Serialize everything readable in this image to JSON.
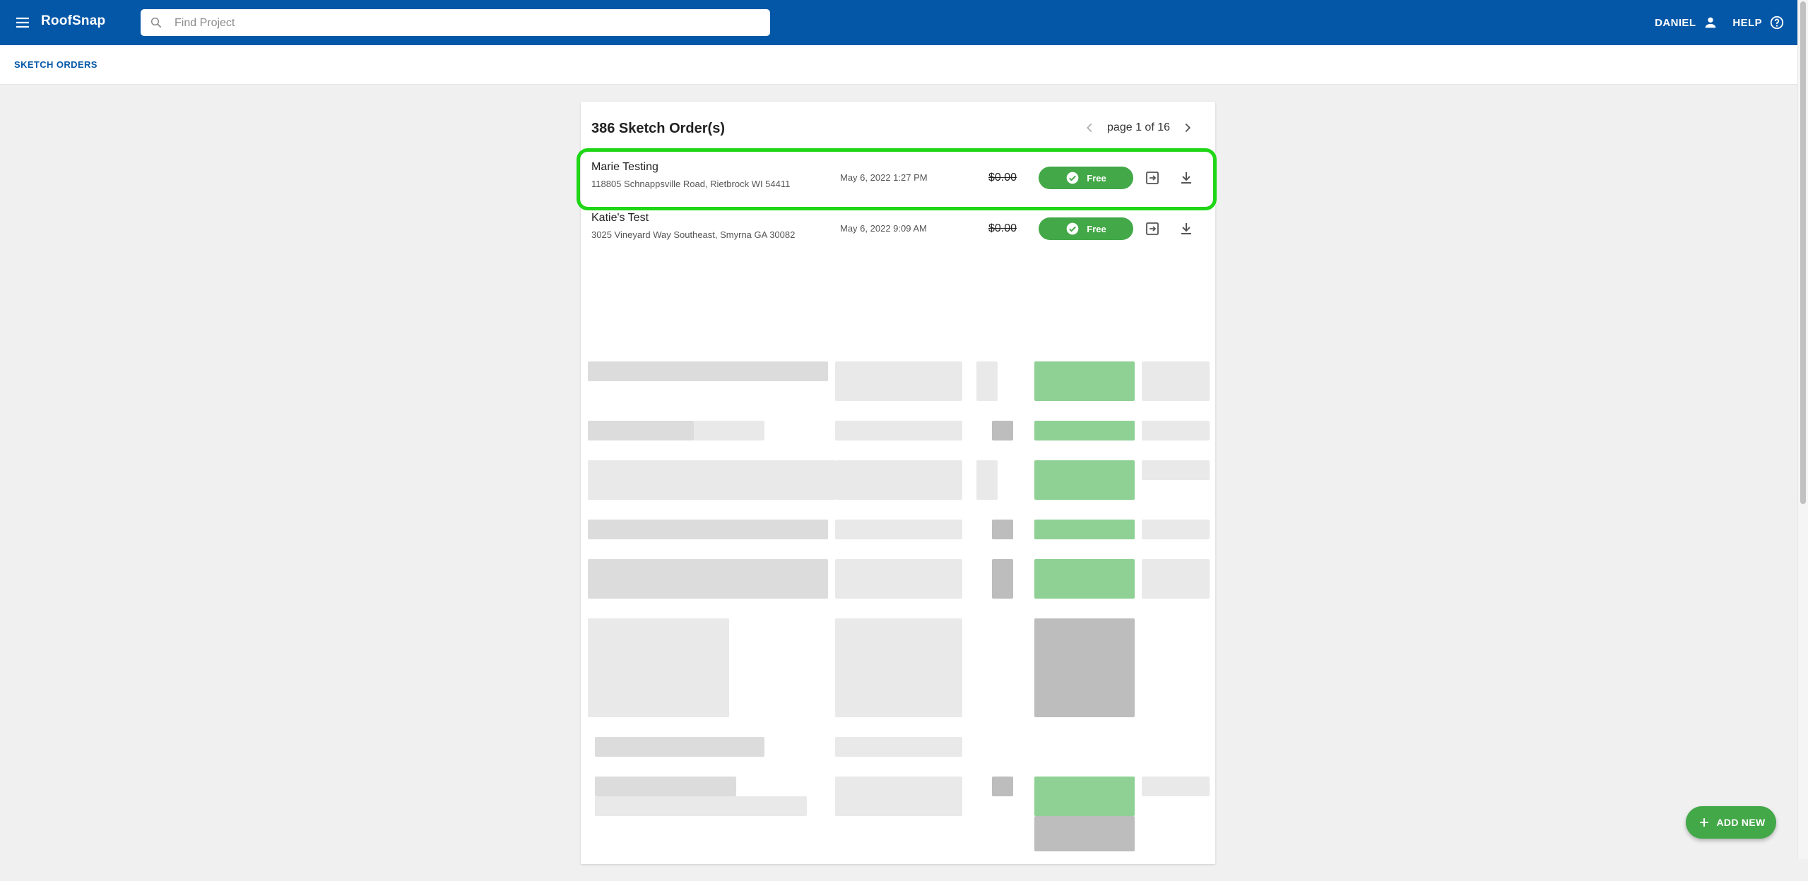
{
  "app": {
    "brand": "RoofSnap",
    "search_placeholder": "Find Project",
    "user_label": "DANIEL",
    "help_label": "HELP",
    "primary_color": "#0457a7",
    "accent_color": "#43a848"
  },
  "subheader": {
    "link": "SKETCH ORDERS"
  },
  "orders": {
    "title": "386 Sketch Order(s)",
    "page_text": "page 1 of 16",
    "rows": [
      {
        "name": "Marie Testing",
        "address": "118805 Schnappsville Road, Rietbrock WI 54411",
        "date": "May 6, 2022 1:27 PM",
        "price": "$0.00",
        "status": "Free",
        "highlighted": true
      },
      {
        "name": "Katie's Test",
        "address": "3025 Vineyard Way Southeast, Smyrna GA 30082",
        "date": "May 6, 2022 9:09 AM",
        "price": "$0.00",
        "status": "Free",
        "highlighted": false
      }
    ],
    "icons": {
      "open": "open-in-icon",
      "download": "download-icon",
      "status": "check-circle-icon"
    }
  },
  "fab": {
    "label": "ADD NEW",
    "icon": "plus-icon"
  }
}
